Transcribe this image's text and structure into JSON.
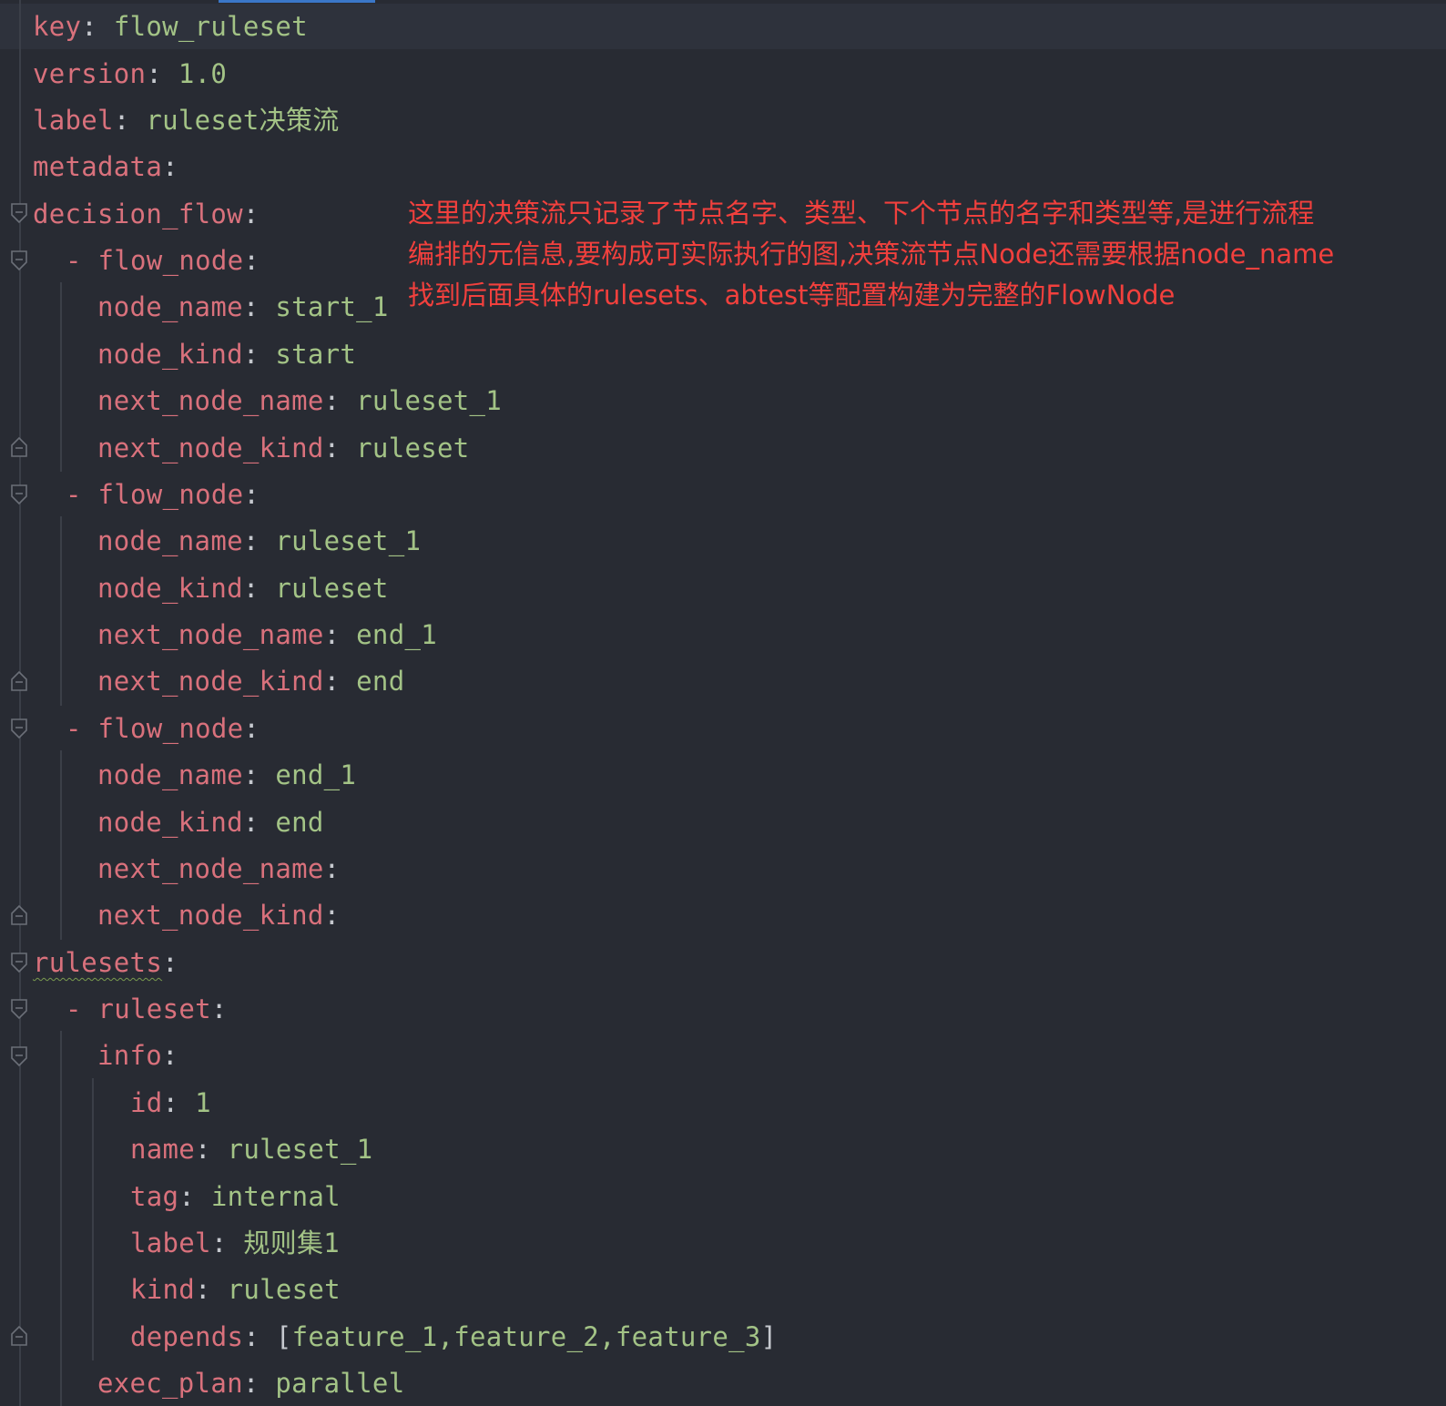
{
  "colors": {
    "background": "#282b33",
    "key": "#d9717c",
    "value": "#a3c386",
    "punctuation": "#c5c8ce",
    "annotation": "#f2403d",
    "tab_accent": "#3a77c8"
  },
  "code": {
    "l1": {
      "key": "key",
      "value": "flow_ruleset"
    },
    "l2": {
      "key": "version",
      "value": "1.0"
    },
    "l3": {
      "key": "label",
      "value": "ruleset决策流"
    },
    "l4": {
      "key": "metadata"
    },
    "l5": {
      "key": "decision_flow"
    },
    "l6": {
      "key": "flow_node"
    },
    "l7": {
      "key": "node_name",
      "value": "start_1"
    },
    "l8": {
      "key": "node_kind",
      "value": "start"
    },
    "l9": {
      "key": "next_node_name",
      "value": "ruleset_1"
    },
    "l10": {
      "key": "next_node_kind",
      "value": "ruleset"
    },
    "l11": {
      "key": "flow_node"
    },
    "l12": {
      "key": "node_name",
      "value": "ruleset_1"
    },
    "l13": {
      "key": "node_kind",
      "value": "ruleset"
    },
    "l14": {
      "key": "next_node_name",
      "value": "end_1"
    },
    "l15": {
      "key": "next_node_kind",
      "value": "end"
    },
    "l16": {
      "key": "flow_node"
    },
    "l17": {
      "key": "node_name",
      "value": "end_1"
    },
    "l18": {
      "key": "node_kind",
      "value": "end"
    },
    "l19": {
      "key": "next_node_name"
    },
    "l20": {
      "key": "next_node_kind"
    },
    "l21": {
      "key": "rulesets"
    },
    "l22": {
      "key": "ruleset"
    },
    "l23": {
      "key": "info"
    },
    "l24": {
      "key": "id",
      "value": "1"
    },
    "l25": {
      "key": "name",
      "value": "ruleset_1"
    },
    "l26": {
      "key": "tag",
      "value": "internal"
    },
    "l27": {
      "key": "label",
      "value": "规则集1"
    },
    "l28": {
      "key": "kind",
      "value": "ruleset"
    },
    "l29": {
      "key": "depends",
      "value_open": "[",
      "value": "feature_1,feature_2,feature_3",
      "value_close": "]"
    },
    "l30": {
      "key": "exec_plan",
      "value": "parallel"
    }
  },
  "annotation": {
    "line1": "这里的决策流只记录了节点名字、类型、下个节点的名字和类型等,是进行流程",
    "line2": "编排的元信息,要构成可实际执行的图,决策流节点Node还需要根据node_name",
    "line3": "找到后面具体的rulesets、abtest等配置构建为完整的FlowNode"
  }
}
